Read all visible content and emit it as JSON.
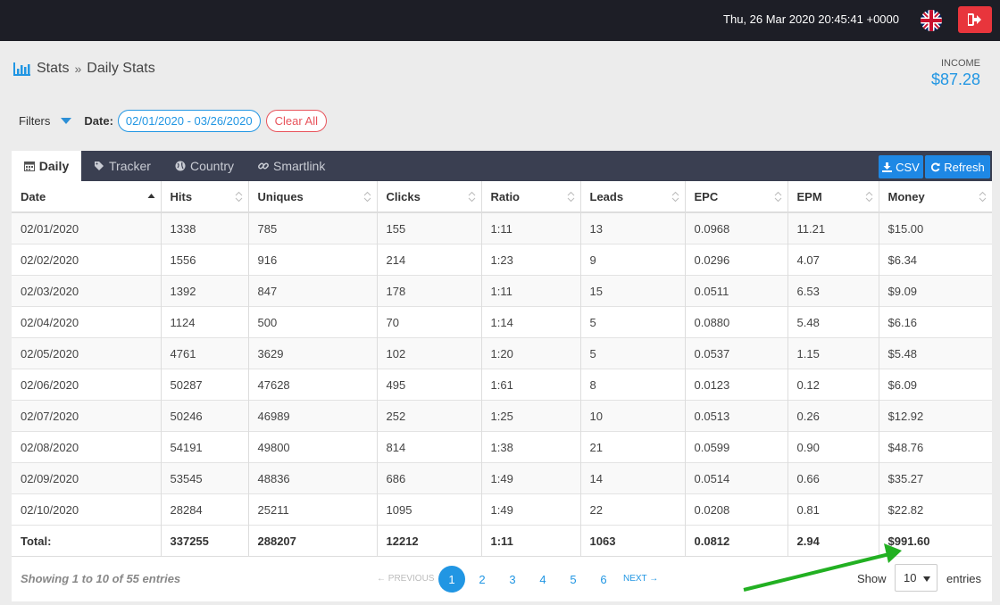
{
  "header": {
    "datetime": "Thu, 26 Mar 2020 20:45:41 +0000",
    "flag_icon": "uk-flag-icon",
    "logout_icon": "sign-out-icon"
  },
  "breadcrumb": {
    "icon": "bar-chart-icon",
    "parent": "Stats",
    "separator": "»",
    "current": "Daily Stats"
  },
  "income": {
    "label": "INCOME",
    "value": "$87.28"
  },
  "filters": {
    "label": "Filters",
    "date_label": "Date:",
    "date_range": "02/01/2020 - 03/26/2020",
    "clear_label": "Clear All"
  },
  "tabs": [
    {
      "label": "Daily",
      "icon": "calendar-icon",
      "active": true
    },
    {
      "label": "Tracker",
      "icon": "tag-icon",
      "active": false
    },
    {
      "label": "Country",
      "icon": "globe-icon",
      "active": false
    },
    {
      "label": "Smartlink",
      "icon": "link-icon",
      "active": false
    }
  ],
  "actions": {
    "csv_label": "CSV",
    "refresh_label": "Refresh"
  },
  "table": {
    "columns": [
      "Date",
      "Hits",
      "Uniques",
      "Clicks",
      "Ratio",
      "Leads",
      "EPC",
      "EPM",
      "Money"
    ],
    "rows": [
      [
        "02/01/2020",
        "1338",
        "785",
        "155",
        "1:11",
        "13",
        "0.0968",
        "11.21",
        "$15.00"
      ],
      [
        "02/02/2020",
        "1556",
        "916",
        "214",
        "1:23",
        "9",
        "0.0296",
        "4.07",
        "$6.34"
      ],
      [
        "02/03/2020",
        "1392",
        "847",
        "178",
        "1:11",
        "15",
        "0.0511",
        "6.53",
        "$9.09"
      ],
      [
        "02/04/2020",
        "1124",
        "500",
        "70",
        "1:14",
        "5",
        "0.0880",
        "5.48",
        "$6.16"
      ],
      [
        "02/05/2020",
        "4761",
        "3629",
        "102",
        "1:20",
        "5",
        "0.0537",
        "1.15",
        "$5.48"
      ],
      [
        "02/06/2020",
        "50287",
        "47628",
        "495",
        "1:61",
        "8",
        "0.0123",
        "0.12",
        "$6.09"
      ],
      [
        "02/07/2020",
        "50246",
        "46989",
        "252",
        "1:25",
        "10",
        "0.0513",
        "0.26",
        "$12.92"
      ],
      [
        "02/08/2020",
        "54191",
        "49800",
        "814",
        "1:38",
        "21",
        "0.0599",
        "0.90",
        "$48.76"
      ],
      [
        "02/09/2020",
        "53545",
        "48836",
        "686",
        "1:49",
        "14",
        "0.0514",
        "0.66",
        "$35.27"
      ],
      [
        "02/10/2020",
        "28284",
        "25211",
        "1095",
        "1:49",
        "22",
        "0.0208",
        "0.81",
        "$22.82"
      ]
    ],
    "total": [
      "Total:",
      "337255",
      "288207",
      "12212",
      "1:11",
      "1063",
      "0.0812",
      "2.94",
      "$991.60"
    ]
  },
  "pagination": {
    "info": "Showing 1 to 10 of 55 entries",
    "prev_label": "← PREVIOUS",
    "next_label": "NEXT →",
    "pages": [
      "1",
      "2",
      "3",
      "4",
      "5",
      "6"
    ],
    "current_page": "1",
    "show_label": "Show",
    "page_size": "10",
    "entries_label": "entries"
  },
  "colors": {
    "accent": "#2196e3",
    "danger": "#e8353c",
    "topbar": "#1d1e26",
    "tabbar": "#3a3f51",
    "annotation_arrow": "#22b022"
  }
}
